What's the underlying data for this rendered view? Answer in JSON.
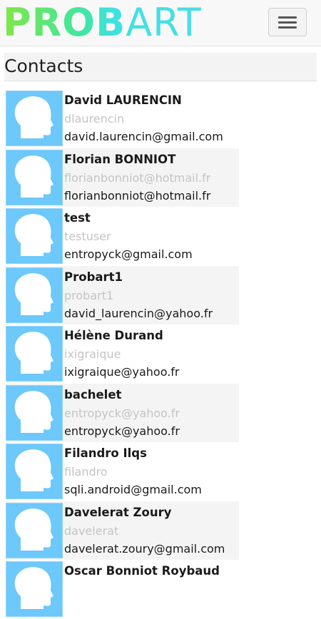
{
  "brand": {
    "logo_bold": "PROB",
    "logo_light": "ART"
  },
  "navbar": {
    "menu_icon": "hamburger-icon"
  },
  "page": {
    "title": "Contacts"
  },
  "contacts": [
    {
      "name": "David LAURENCIN",
      "username": "dlaurencin",
      "email": "david.laurencin@gmail.com"
    },
    {
      "name": "Florian BONNIOT",
      "username": "florianbonniot@hotmail.fr",
      "email": "florianbonniot@hotmail.fr"
    },
    {
      "name": "test",
      "username": "testuser",
      "email": "entropyck@gmail.com"
    },
    {
      "name": "Probart1",
      "username": "probart1",
      "email": "david_laurencin@yahoo.fr"
    },
    {
      "name": "Hélène Durand",
      "username": "ixigraique",
      "email": "ixigraique@yahoo.fr"
    },
    {
      "name": "bachelet",
      "username": "entropyck@yahoo.fr",
      "email": "entropyck@yahoo.fr"
    },
    {
      "name": "Filandro Ilqs",
      "username": "filandro",
      "email": "sqli.android@gmail.com"
    },
    {
      "name": "Davelerat Zoury",
      "username": "davelerat",
      "email": "davelerat.zoury@gmail.com"
    },
    {
      "name": "Oscar Bonniot Roybaud",
      "username": "",
      "email": ""
    }
  ],
  "colors": {
    "avatar_bg": "#6dc8fb",
    "row_alt_bg": "#f4f4f4"
  }
}
